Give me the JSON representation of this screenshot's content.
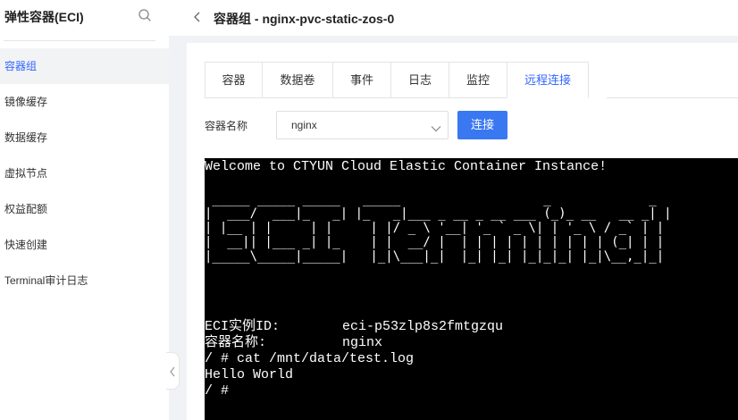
{
  "sidebar": {
    "title": "弹性容器(ECI)",
    "items": [
      {
        "label": "容器组",
        "active": true
      },
      {
        "label": "镜像缓存",
        "active": false
      },
      {
        "label": "数据缓存",
        "active": false
      },
      {
        "label": "虚拟节点",
        "active": false
      },
      {
        "label": "权益配额",
        "active": false
      },
      {
        "label": "快速创建",
        "active": false
      },
      {
        "label": "Terminal审计日志",
        "active": false
      }
    ]
  },
  "header": {
    "title": "容器组 - nginx-pvc-static-zos-0"
  },
  "tabs": [
    {
      "label": "容器",
      "active": false
    },
    {
      "label": "数据卷",
      "active": false
    },
    {
      "label": "事件",
      "active": false
    },
    {
      "label": "日志",
      "active": false
    },
    {
      "label": "监控",
      "active": false
    },
    {
      "label": "远程连接",
      "active": true
    }
  ],
  "form": {
    "container_label": "容器名称",
    "container_value": "nginx",
    "connect_label": "连接"
  },
  "terminal": {
    "welcome": "Welcome to CTYUN Cloud Elastic Container Instance!",
    "banner": " _____ _____ _____   _____                   _             _\n|  ___/  ___|_   _| |_   _|___ _ __ _ __ ___ (_)_ __   __ _| |\n| |__ | |     | |     | |/ _ \\ '__| '_ ` _ \\| | '_ \\ / _` | |\n|  __|| |___ _| |_    | |  __/ |  | | | | | | | | | | (_| | |\n|_____\\_____|_____|   |_|\\___|_|  |_| |_| |_|_|_| |_|\\__,_|_|",
    "id_label": "ECI实例ID:",
    "id_value": "eci-p53zlp8s2fmtgzqu",
    "name_label": "容器名称:",
    "name_value": "nginx",
    "command": "/ # cat /mnt/data/test.log",
    "output": "Hello World",
    "prompt": "/ #"
  },
  "colors": {
    "accent": "#3366ff",
    "button": "#3a78f2",
    "terminal_bg": "#000000",
    "main_bg": "#f0f2f5"
  },
  "icons": {
    "search": "search-icon",
    "back": "chevron-left-icon",
    "dropdown": "chevron-down-icon",
    "collapse": "chevron-left-icon"
  }
}
